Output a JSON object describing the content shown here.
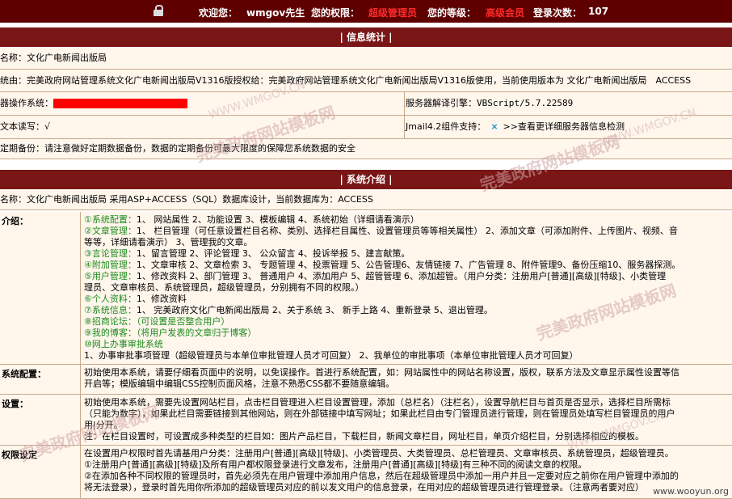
{
  "header": {
    "welcome_label": "欢迎您：",
    "username": "wmgov先生",
    "permission_label": "您的权限：",
    "permission_value": "超级管理员",
    "level_label": "您的等级：",
    "level_value": "高级会员",
    "login_count_label": "登录次数：",
    "login_count_value": "107"
  },
  "info_stats": {
    "title": "| 信息统计 |",
    "site_name": "名称：文化广电新闻出版局",
    "system_line": "统由：完美政府网站管理系统文化广电新闻出版局V1316版授权给：完美政府网站管理系统文化广电新闻出版局V1316版使用，当前使用版本为 文化广电新闻出版局　ACCESS",
    "os_label": "器操作系统：",
    "engine": "服务器解译引擎：VBScript/5.7.22589",
    "rw_label": "文本读写：",
    "rw_value": "√",
    "jmail": "Jmail4.2组件支持：",
    "jmail_mark": "×",
    "jmail_link": ">>查看更详细服务器信息检测",
    "backup": "定期备份：请注意做好定期数据备份，数据的定期备份可最大限度的保障您系统数据的安全"
  },
  "intro": {
    "title": "| 系统介绍 |",
    "summary": "名称：文化广电新闻出版局 采用ASP+ACCESS（SQL）数据库设计，当前数据库为：ACCESS",
    "rows": [
      {
        "label": "介绍：",
        "lines": [
          {
            "lead": "①系统配置：",
            "text": "1、 网站属性 2、功能设置 3、模板编辑 4、系统初始（详细请看演示）"
          },
          {
            "lead": "②文章管理：",
            "text": "1、 栏目管理（可任意设置栏目名称、类别、选择栏目属性、设置管理员等等相关属性） 2、添加文章（可添加附件、上传图片、视频、音"
          },
          {
            "lead": "",
            "text": "等等，详细请看演示） 3、管理我的文章。"
          },
          {
            "lead": "③言论管理：",
            "text": "1、留言管理 2、评论管理 3、 公众留言 4、投诉举报 5、建言献策。"
          },
          {
            "lead": "④附加管理：",
            "text": "1、文章审核 2、文章检索 3、 专题管理 4、投票管理 5、公告管理6、友情链接 7、广告管理 8、附件管理9、备份压缩10、服务器探测。"
          },
          {
            "lead": "⑤用户管理：",
            "text": "1、修改资料 2、部门管理 3、 普通用户 4、添加用户 5、超管管理 6、添加超管。（用户分类：注册用户[普通][高级][特级]、小类管理"
          },
          {
            "lead": "",
            "text": "理员、文章审核员、系统管理员，超级管理员，分别拥有不同的权限。）"
          },
          {
            "lead": "⑥个人资料：",
            "text": "1、修改资料"
          },
          {
            "lead": "⑦系统信息：",
            "text": "1、 完美政府文化广电新闻出版局 2、关于系统 3、 新手上路 4、重新登录 5、退出管理。"
          },
          {
            "lead": "⑧招商论坛：（可设置是否整合用户）",
            "text": ""
          },
          {
            "lead": "⑨我的博客：（将用户发表的文章归于博客）",
            "text": ""
          },
          {
            "lead": "⑩网上办事审批系统",
            "text": ""
          },
          {
            "lead": "",
            "text": "1、办事审批事项管理（超级管理员与本单位审批管理人员才可回复） 2、我单位的审批事项（本单位审批管理人员才可回复）"
          }
        ]
      },
      {
        "label": "系统配置：",
        "lines": [
          {
            "lead": "",
            "text": "初始使用本系统，请要仔细看页面中的说明，以免误操作。首进行系统配置，如：网站属性中的网站名称设置，版权，联系方法及文章显示属性设置等信"
          },
          {
            "lead": "",
            "text": "开启等；模版编辑中编辑CSS控制页面风格，注意不熟悉CSS都不要随意编辑。"
          }
        ]
      },
      {
        "label": "设置：",
        "lines": [
          {
            "lead": "",
            "text": "初始使用本系统，需要先设置网站栏目，点击栏目管理进入栏目设置管理，添加（总栏名）（注栏名），设置导航栏目与首页是否显示，选择栏目所需标"
          },
          {
            "lead": "",
            "text": "（只能为数字），如果此栏目需要链接到其他网站，则在外部链接中填写网址；如果此栏目由专门管理员进行管理，则在管理员处填写栏目管理员的用户"
          },
          {
            "lead": "",
            "text": "用|分开。"
          },
          {
            "lead": "",
            "text": "注：在栏目设置时，可设置成多种类型的栏目如：图片产品栏目，下载栏目，新闻文章栏目，网址栏目，单页介绍栏目，分别选择相应的模板。"
          }
        ]
      },
      {
        "label": "权限设定",
        "lines": [
          {
            "lead": "",
            "text": "在设置用户权限时首先请基用户分类：注册用户[普通][高级][特级]、小类管理员、大类管理员、总栏管理员、文章审核员、系统管理员，超级管理员。"
          },
          {
            "lead": "",
            "text": "①注册用户[普通][高级][特级]及所有用户都权限登录进行文章发布，注册用户[普通][高级][特级]有三种不同的阅读文章的权限。"
          },
          {
            "lead": "",
            "text": "②在添加各种不同权限的管理员时，首先必须先在用户管理中添加用户信息，然后在超级管理员中添加一用户并且一定要对应之前你在用户管理中添加的"
          },
          {
            "lead": "",
            "text": "将无法登录），登录时首先用你所添加的超级管理员对应的前以发文用户的信息登录，在用对应的超级管理员进行管理登录。（注意两者要对应）"
          }
        ]
      }
    ]
  },
  "watermarks": {
    "url_text": "WWW.WMGOV.CN",
    "brand_text": "完美政府网站模板网",
    "corner": "www.wooyun.org"
  },
  "colors": {
    "header_bg": "#5e0000",
    "section_bg": "#7a1616",
    "row_bg": "#fff6ec",
    "accent_green": "#1c8a1c",
    "alert_red": "#ff0000"
  }
}
